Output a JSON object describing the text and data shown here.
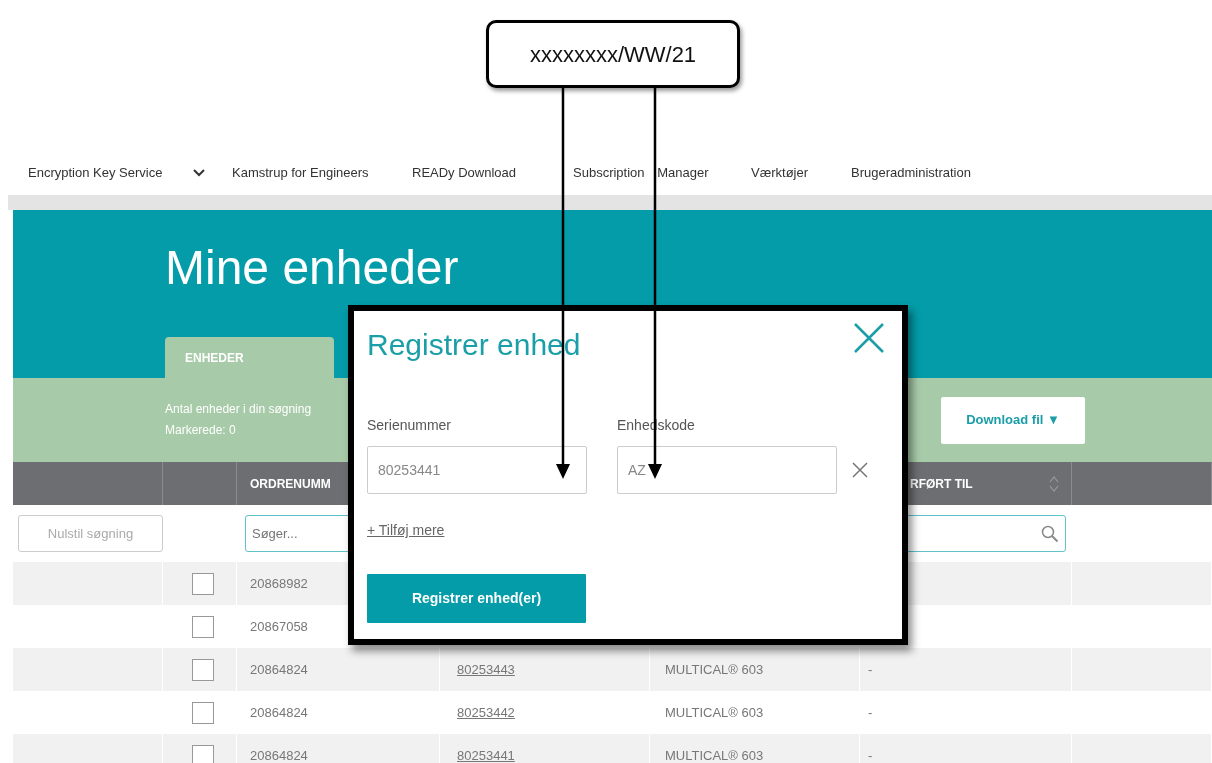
{
  "callout": {
    "text": "xxxxxxxx/WW/21"
  },
  "nav": {
    "items": [
      {
        "label": "Encryption Key Service",
        "dropdown": true
      },
      {
        "label": "Kamstrup for Engineers",
        "dropdown": false
      },
      {
        "label": "READy Download",
        "dropdown": false
      },
      {
        "label": "Subscription Manager",
        "dropdown": false
      },
      {
        "label": "Værktøjer",
        "dropdown": false
      },
      {
        "label": "Brugeradministration",
        "dropdown": false
      }
    ]
  },
  "page": {
    "title": "Mine enheder"
  },
  "tabs": [
    {
      "label": "ENHEDER",
      "selected": true
    }
  ],
  "summary": {
    "lines": [
      "Antal enheder i din søgning",
      "Markerede: 0"
    ]
  },
  "download_button": {
    "label": "Download fil",
    "caret": "▼"
  },
  "table": {
    "columns": {
      "column_3": {
        "label": "ORDRENUMM",
        "sortable": false
      },
      "column_6": {
        "label": "RFØRT TIL",
        "sortable": true
      }
    },
    "reset_button": "Nulstil søgning",
    "filters": {
      "column_3": {
        "placeholder": "Søger..."
      },
      "column_6": {
        "kind": "search"
      }
    },
    "rows": [
      {
        "checked": false,
        "order": "20868982"
      },
      {
        "checked": false,
        "order": "20867058"
      },
      {
        "checked": false,
        "order": "20864824",
        "serial": "80253443",
        "product": "MULTICAL® 603",
        "transferred": "-"
      },
      {
        "checked": false,
        "order": "20864824",
        "serial": "80253442",
        "product": "MULTICAL® 603",
        "transferred": "-"
      },
      {
        "checked": false,
        "order": "20864824",
        "serial": "80253441",
        "product": "MULTICAL® 603",
        "transferred": "-"
      }
    ]
  },
  "modal": {
    "title": "Registrer enhed",
    "fields": [
      {
        "label": "Serienummer",
        "value": "80253441",
        "removable": false
      },
      {
        "label": "Enhedskode",
        "value": "AZ",
        "removable": true
      }
    ],
    "add_link": "+ Tilføj mere",
    "submit": "Registrer enhed(er)"
  }
}
